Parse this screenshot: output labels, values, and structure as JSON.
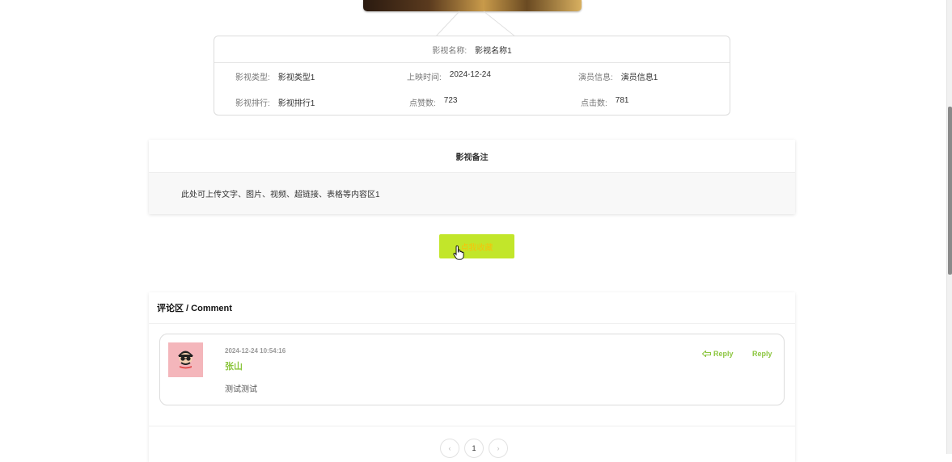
{
  "info": {
    "name_label": "影视名称:",
    "name_value": "影视名称1",
    "type_label": "影视类型:",
    "type_value": "影视类型1",
    "date_label": "上映时间:",
    "date_value": "2024-12-24",
    "actor_label": "演员信息:",
    "actor_value": "演员信息1",
    "rank_label": "影视排行:",
    "rank_value": "影视排行1",
    "likes_label": "点赞数:",
    "likes_value": "723",
    "clicks_label": "点击数:",
    "clicks_value": "781"
  },
  "remarks": {
    "title": "影视备注",
    "content": "此处可上传文字、图片、视频、超链接、表格等内容区1"
  },
  "favorite_button": {
    "label": "点我收藏"
  },
  "comments": {
    "title": "评论区 / Comment",
    "items": [
      {
        "time": "2024-12-24 10:54:16",
        "author": "张山",
        "text": "测试测试",
        "reply_icon_label": "Reply",
        "reply_label": "Reply"
      }
    ],
    "pagination": {
      "prev": "‹",
      "current": "1",
      "next": "›"
    }
  },
  "colors": {
    "accent": "#8cc63f",
    "button_bg": "#c2e62a",
    "button_text": "#f5c30b"
  }
}
